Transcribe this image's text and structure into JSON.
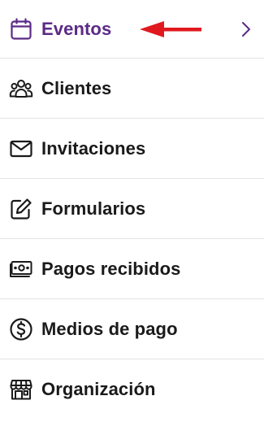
{
  "menu": {
    "items": [
      {
        "label": "Eventos",
        "icon": "calendar-icon",
        "active": true
      },
      {
        "label": "Clientes",
        "icon": "users-icon"
      },
      {
        "label": "Invitaciones",
        "icon": "envelope-icon"
      },
      {
        "label": "Formularios",
        "icon": "form-edit-icon"
      },
      {
        "label": "Pagos recibidos",
        "icon": "banknote-icon"
      },
      {
        "label": "Medios de pago",
        "icon": "dollar-circle-icon"
      },
      {
        "label": "Organización",
        "icon": "storefront-icon"
      }
    ]
  },
  "colors": {
    "active": "#5b2a86",
    "text": "#1a1a1a",
    "divider": "#e4e4e4",
    "arrow": "#e0191f"
  }
}
